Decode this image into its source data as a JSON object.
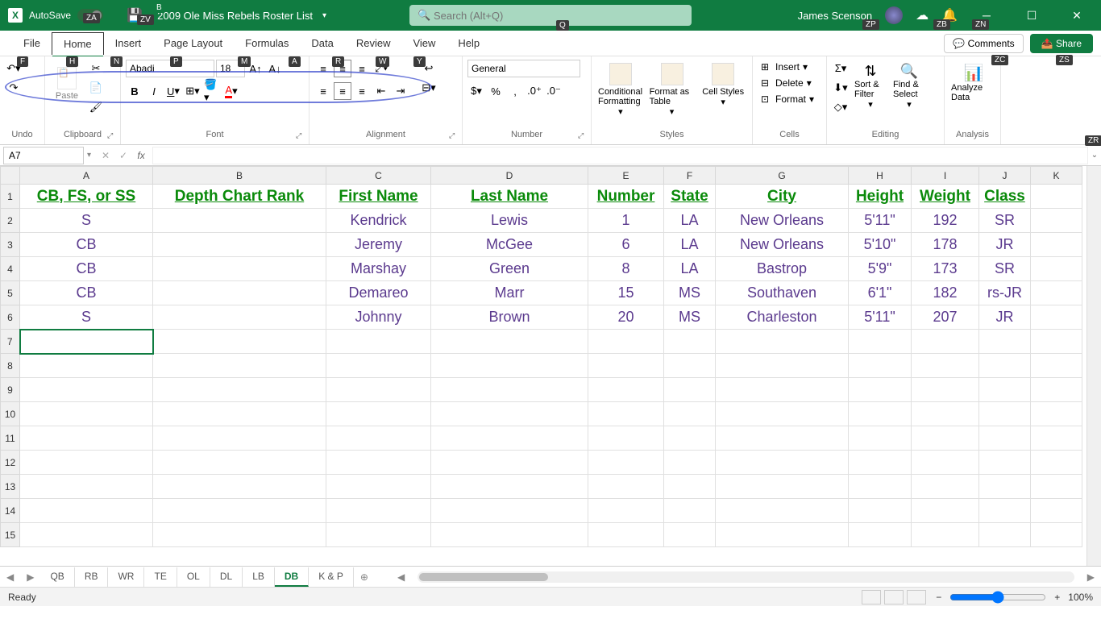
{
  "titlebar": {
    "autosave": "AutoSave",
    "autosave_state": "Off",
    "filename": "2009 Ole Miss Rebels Roster List",
    "search_placeholder": "Search (Alt+Q)",
    "user": "James Scenson"
  },
  "key_tips": {
    "za": "ZA",
    "zv": "ZV",
    "b": "B",
    "q": "Q",
    "zp": "ZP",
    "zb": "ZB",
    "zn": "ZN",
    "zc": "ZC",
    "zs": "ZS",
    "f": "F",
    "h": "H",
    "n": "N",
    "p": "P",
    "m": "M",
    "a": "A",
    "r": "R",
    "w": "W",
    "y": "Y",
    "zr": "ZR"
  },
  "tabs": {
    "file": "File",
    "home": "Home",
    "insert": "Insert",
    "page_layout": "Page Layout",
    "formulas": "Formulas",
    "data": "Data",
    "review": "Review",
    "view": "View",
    "help": "Help",
    "comments": "Comments",
    "share": "Share"
  },
  "ribbon": {
    "undo": "Undo",
    "clipboard": "Clipboard",
    "paste": "Paste",
    "font": "Font",
    "font_name": "Abadi",
    "font_size": "18",
    "alignment": "Alignment",
    "number": "Number",
    "number_format": "General",
    "styles": "Styles",
    "cond_fmt": "Conditional Formatting",
    "fmt_table": "Format as Table",
    "cell_styles": "Cell Styles",
    "cells": "Cells",
    "insert_cell": "Insert",
    "delete_cell": "Delete",
    "format_cell": "Format",
    "editing": "Editing",
    "sort_filter": "Sort & Filter",
    "find_select": "Find & Select",
    "analysis": "Analysis",
    "analyze": "Analyze Data"
  },
  "formula": {
    "name_box": "A7",
    "fx": "fx"
  },
  "columns": [
    "A",
    "B",
    "C",
    "D",
    "E",
    "F",
    "G",
    "H",
    "I",
    "J",
    "K"
  ],
  "rows": [
    "1",
    "2",
    "3",
    "4",
    "5",
    "6",
    "7",
    "8",
    "9",
    "10",
    "11",
    "12",
    "13",
    "14",
    "15"
  ],
  "headers": {
    "A": "CB, FS, or SS",
    "B": "Depth Chart Rank",
    "C": "First Name",
    "D": "Last Name",
    "E": "Number",
    "F": "State",
    "G": "City",
    "H": "Height",
    "I": "Weight",
    "J": "Class"
  },
  "data_rows": [
    {
      "A": "S",
      "B": "",
      "C": "Kendrick",
      "D": "Lewis",
      "E": "1",
      "F": "LA",
      "G": "New Orleans",
      "H": "5'11\"",
      "I": "192",
      "J": "SR"
    },
    {
      "A": "CB",
      "B": "",
      "C": "Jeremy",
      "D": "McGee",
      "E": "6",
      "F": "LA",
      "G": "New Orleans",
      "H": "5'10\"",
      "I": "178",
      "J": "JR"
    },
    {
      "A": "CB",
      "B": "",
      "C": "Marshay",
      "D": "Green",
      "E": "8",
      "F": "LA",
      "G": "Bastrop",
      "H": "5'9\"",
      "I": "173",
      "J": "SR"
    },
    {
      "A": "CB",
      "B": "",
      "C": "Demareo",
      "D": "Marr",
      "E": "15",
      "F": "MS",
      "G": "Southaven",
      "H": "6'1\"",
      "I": "182",
      "J": "rs-JR"
    },
    {
      "A": "S",
      "B": "",
      "C": "Johnny",
      "D": "Brown",
      "E": "20",
      "F": "MS",
      "G": "Charleston",
      "H": "5'11\"",
      "I": "207",
      "J": "JR"
    }
  ],
  "sheets": [
    "QB",
    "RB",
    "WR",
    "TE",
    "OL",
    "DL",
    "LB",
    "DB",
    "K & P"
  ],
  "active_sheet": "DB",
  "status": {
    "ready": "Ready",
    "zoom": "100%"
  }
}
